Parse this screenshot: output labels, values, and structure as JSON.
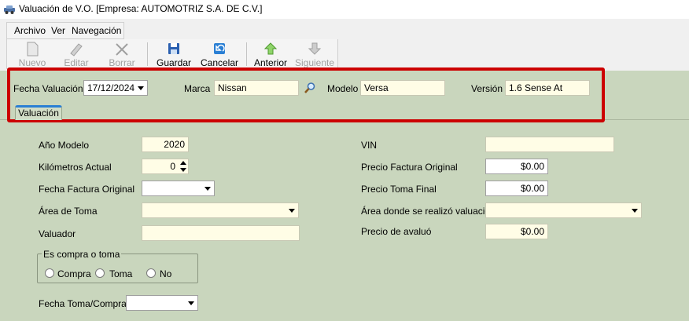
{
  "window": {
    "title": "Valuación de V.O. [Empresa: AUTOMOTRIZ S.A. DE C.V.]"
  },
  "menu": {
    "items": [
      "Archivo",
      "Ver",
      "Navegación"
    ]
  },
  "toolbar": {
    "nuevo": "Nuevo",
    "editar": "Editar",
    "borrar": "Borrar",
    "guardar": "Guardar",
    "cancelar": "Cancelar",
    "anterior": "Anterior",
    "siguiente": "Siguiente"
  },
  "header": {
    "fecha_label": "Fecha Valuación",
    "fecha_value": "17/12/2024",
    "marca_label": "Marca",
    "marca_value": "Nissan",
    "modelo_label": "Modelo",
    "modelo_value": "Versa",
    "version_label": "Versión",
    "version_value": "1.6 Sense At"
  },
  "tab": {
    "label": "Valuación"
  },
  "form": {
    "anio_label": "Año Modelo",
    "anio_value": "2020",
    "km_label": "Kilómetros Actual",
    "km_value": "0",
    "fecha_factura_label": "Fecha Factura Original",
    "fecha_factura_value": "",
    "area_toma_label": "Área de Toma",
    "area_toma_value": "",
    "valuador_label": "Valuador",
    "valuador_value": "",
    "group_label": "Es compra o toma",
    "radio_compra": "Compra",
    "radio_toma": "Toma",
    "radio_no": "No",
    "fecha_toma_label": "Fecha Toma/Compra",
    "fecha_toma_value": "",
    "vin_label": "VIN",
    "vin_value": "",
    "precio_factura_label": "Precio Factura Original",
    "precio_factura_value": "$0.00",
    "precio_toma_label": "Precio Toma Final",
    "precio_toma_value": "$0.00",
    "area_valuacion_label": "Área donde se realizó valuación",
    "area_valuacion_value": "",
    "precio_avaluo_label": "Precio de avaluó",
    "precio_avaluo_value": "$0.00"
  },
  "colors": {
    "panel_green": "#c9d6bd",
    "field_yellow": "#fffde6",
    "highlight_red": "#cc0000",
    "tab_accent": "#2a7fd4"
  }
}
